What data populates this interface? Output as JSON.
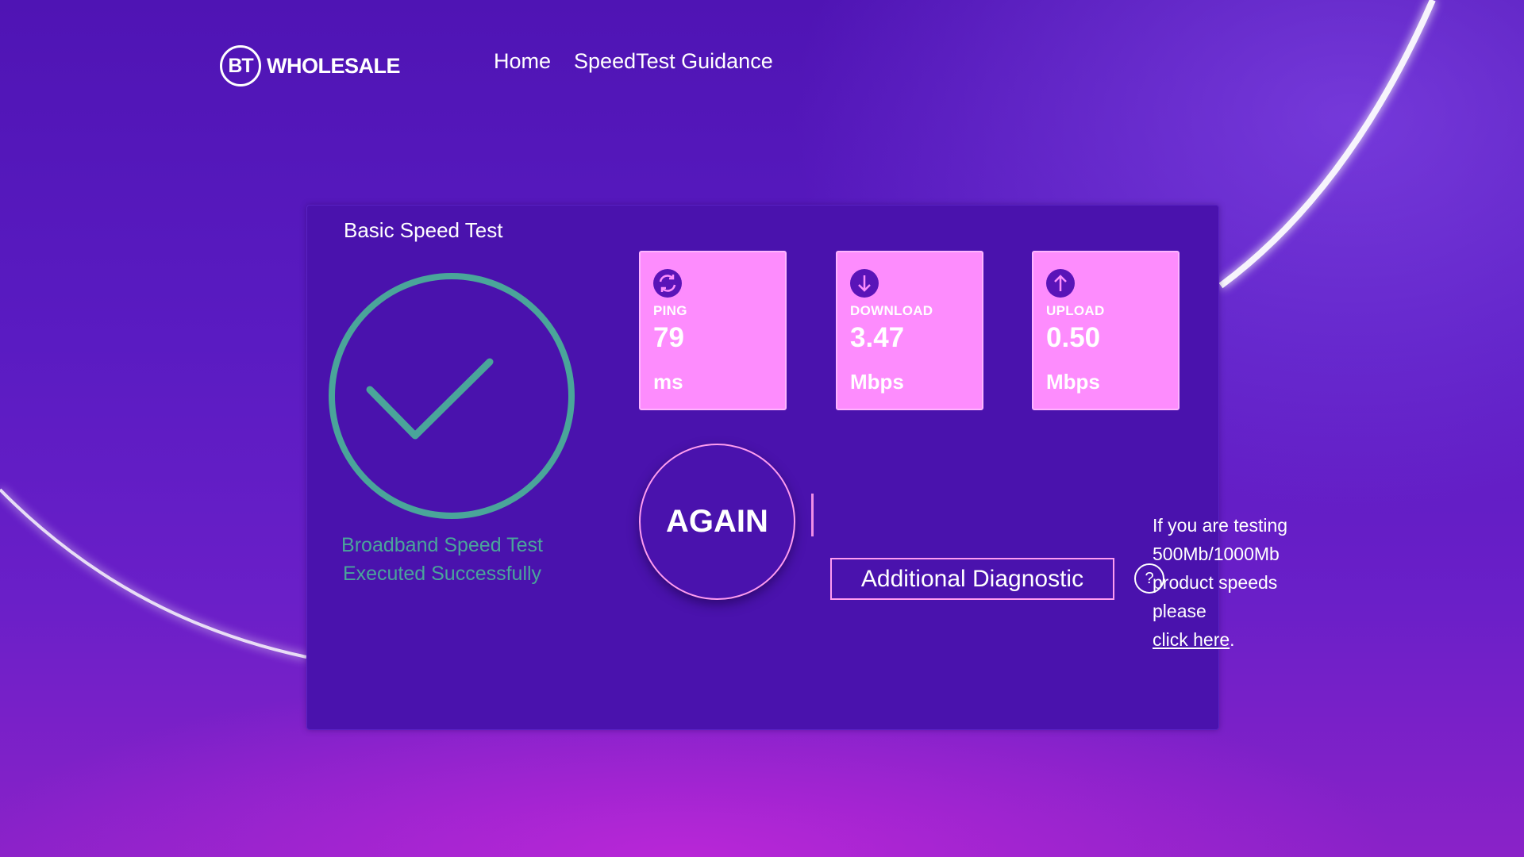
{
  "header": {
    "logo_mark": "BT",
    "logo_text": "WHOLESALE",
    "nav": [
      {
        "label": "Home"
      },
      {
        "label": "SpeedTest Guidance"
      }
    ]
  },
  "panel": {
    "title": "Basic Speed Test",
    "status_line1": "Broadband Speed Test",
    "status_line2": "Executed Successfully",
    "metrics": [
      {
        "icon": "refresh-icon",
        "label": "PING",
        "value": "79",
        "unit": "ms"
      },
      {
        "icon": "arrow-down-icon",
        "label": "DOWNLOAD",
        "value": "3.47",
        "unit": "Mbps"
      },
      {
        "icon": "arrow-up-icon",
        "label": "UPLOAD",
        "value": "0.50",
        "unit": "Mbps"
      }
    ],
    "again_label": "AGAIN",
    "diagnostic_label": "Additional Diagnostic"
  },
  "help": {
    "icon": "question-icon",
    "glyph": "?",
    "text": "If you are testing 500Mb/1000Mb product speeds please",
    "link_label": "click here",
    "suffix": "."
  },
  "colors": {
    "panel_bg": "#4a12ad",
    "metric_bg": "#fd8cfd",
    "success": "#4aa59a",
    "accent_border": "#ff9cf0"
  }
}
